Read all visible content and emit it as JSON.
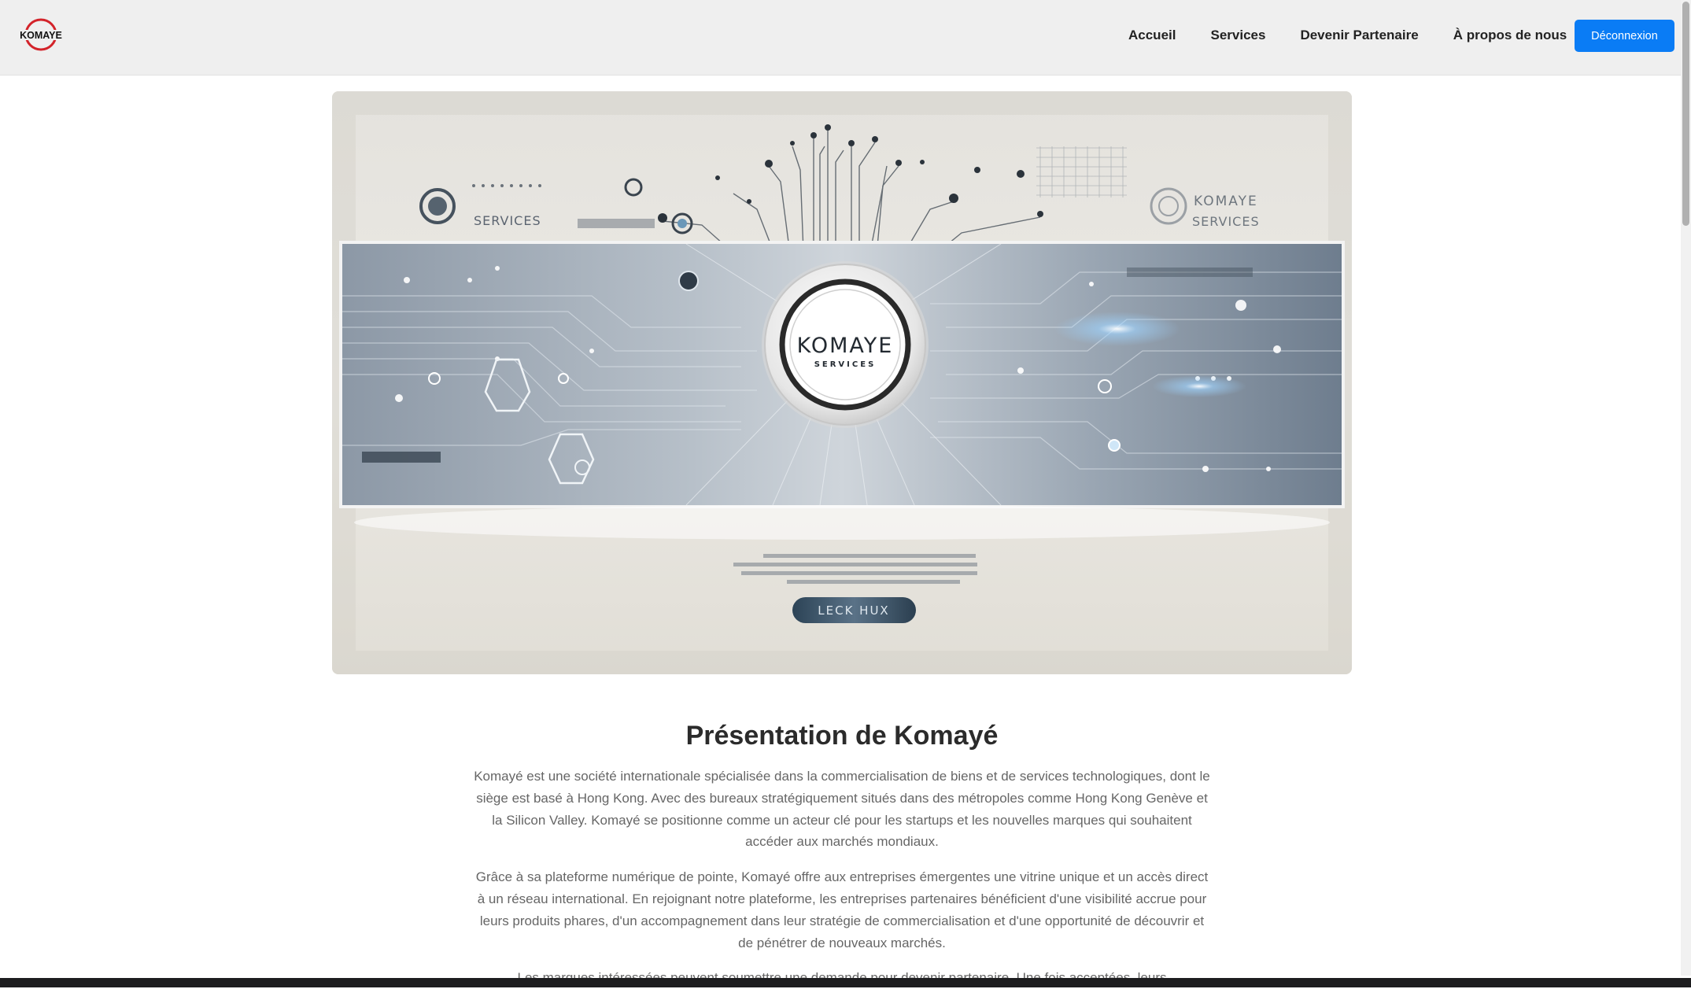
{
  "brand": {
    "logo_text": "KOMAYE",
    "accent": "#d3232a"
  },
  "nav": {
    "links": [
      "Accueil",
      "Services",
      "Devenir Partenaire",
      "À propos de nous"
    ],
    "logout_label": "Déconnexion",
    "logout_color": "#0a7cf5"
  },
  "hero": {
    "brand_name": "KOMAYE",
    "brand_sub": "SERVICES",
    "top_left_label": "SERVICES",
    "top_right_title": "KOMAYE",
    "top_right_sub": "SERVICES",
    "cta_label": "LECK HUX"
  },
  "section": {
    "title": "Présentation de Komayé",
    "paragraphs": [
      "Komayé est une société internationale spécialisée dans la commercialisation de biens et de services technologiques, dont le siège est basé à Hong Kong. Avec des bureaux stratégiquement situés dans des métropoles comme Hong Kong Genève et la Silicon Valley. Komayé se positionne comme un acteur clé pour les startups et les nouvelles marques qui souhaitent accéder aux marchés mondiaux.",
      "Grâce à sa plateforme numérique de pointe, Komayé offre aux entreprises émergentes une vitrine unique et un accès direct à un réseau international. En rejoignant notre plateforme, les entreprises partenaires bénéficient d'une visibilité accrue pour leurs produits phares, d'un accompagnement dans leur stratégie de commercialisation et d'une opportunité de découvrir et de pénétrer de nouveaux marchés.",
      "Les marques intéressées peuvent soumettre une demande pour devenir partenaire. Une fois acceptées, leurs"
    ]
  }
}
